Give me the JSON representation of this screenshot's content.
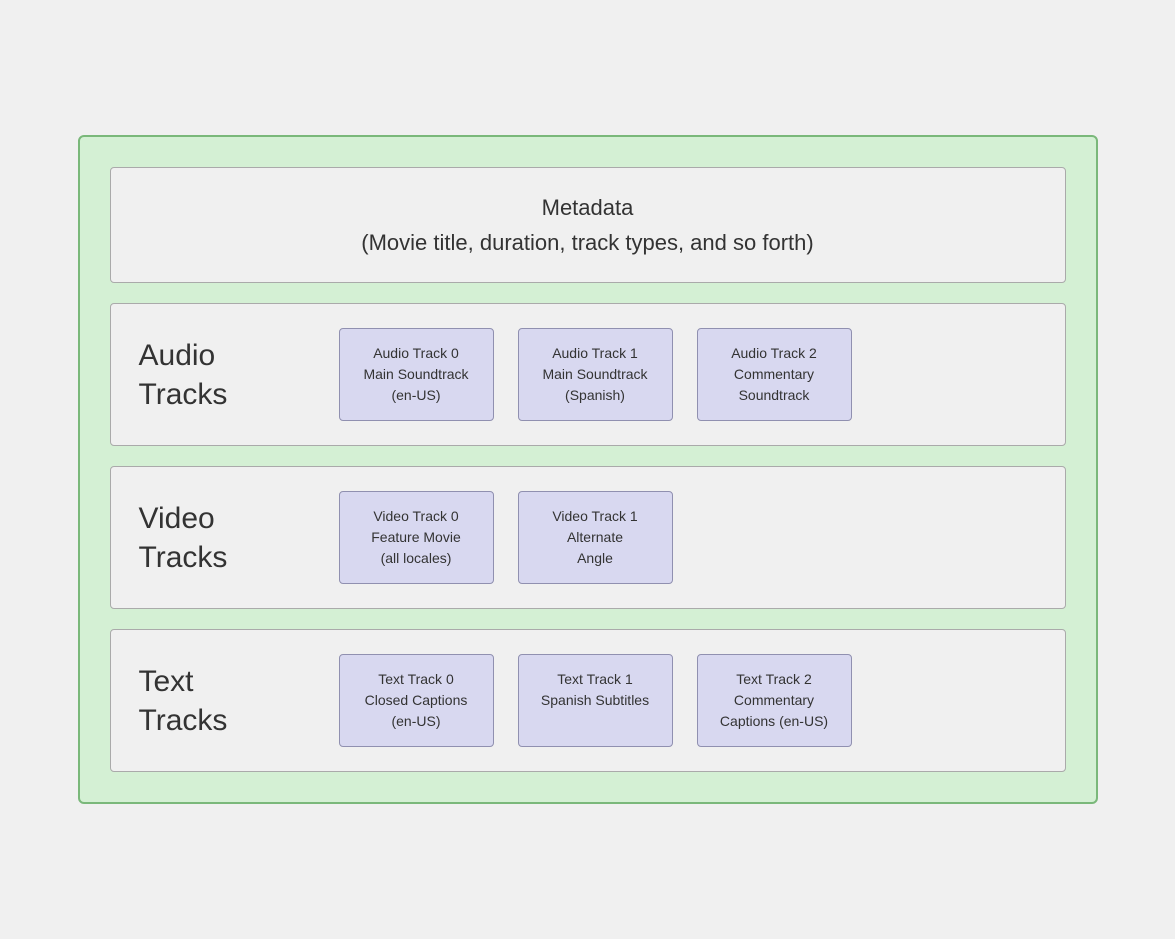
{
  "metadata": {
    "title": "Metadata",
    "subtitle": "(Movie title, duration, track types, and so forth)"
  },
  "sections": [
    {
      "id": "audio-tracks",
      "label": "Audio\nTracks",
      "tracks": [
        {
          "id": "audio-track-0",
          "text": "Audio Track 0\nMain Soundtrack\n(en-US)"
        },
        {
          "id": "audio-track-1",
          "text": "Audio Track 1\nMain Soundtrack\n(Spanish)"
        },
        {
          "id": "audio-track-2",
          "text": "Audio Track 2\nCommentary\nSoundtrack"
        }
      ]
    },
    {
      "id": "video-tracks",
      "label": "Video\nTracks",
      "tracks": [
        {
          "id": "video-track-0",
          "text": "Video Track 0\nFeature Movie\n(all locales)"
        },
        {
          "id": "video-track-1",
          "text": "Video Track 1\nAlternate\nAngle"
        }
      ]
    },
    {
      "id": "text-tracks",
      "label": "Text\nTracks",
      "tracks": [
        {
          "id": "text-track-0",
          "text": "Text Track 0\nClosed Captions\n(en-US)"
        },
        {
          "id": "text-track-1",
          "text": "Text Track 1\nSpanish Subtitles"
        },
        {
          "id": "text-track-2",
          "text": "Text Track 2\nCommentary\nCaptions (en-US)"
        }
      ]
    }
  ]
}
